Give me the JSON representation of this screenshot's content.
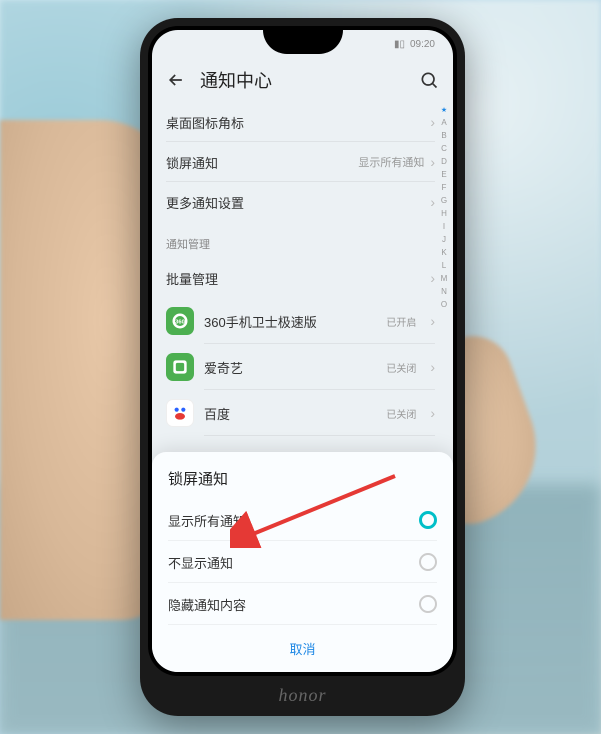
{
  "status": {
    "time": "09:20"
  },
  "header": {
    "title": "通知中心"
  },
  "rows": [
    {
      "label": "桌面图标角标",
      "value": ""
    },
    {
      "label": "锁屏通知",
      "value": "显示所有通知"
    },
    {
      "label": "更多通知设置",
      "value": ""
    }
  ],
  "sections": {
    "manage": "通知管理",
    "batch": "批量管理"
  },
  "apps": [
    {
      "name": "360手机卫士极速版",
      "status": "已开启",
      "icon_bg": "#4caf50",
      "icon_glyph": "360"
    },
    {
      "name": "爱奇艺",
      "status": "已关闭",
      "icon_bg": "#4caf50",
      "icon_glyph": "iQ"
    },
    {
      "name": "百度",
      "status": "已关闭",
      "icon_bg": "#2196f3",
      "icon_glyph": "B"
    }
  ],
  "index_letters": [
    "★",
    "A",
    "B",
    "C",
    "D",
    "E",
    "F",
    "G",
    "H",
    "I",
    "J",
    "K",
    "L",
    "M",
    "N",
    "O"
  ],
  "sheet": {
    "title": "锁屏通知",
    "options": [
      {
        "label": "显示所有通知",
        "selected": true
      },
      {
        "label": "不显示通知",
        "selected": false
      },
      {
        "label": "隐藏通知内容",
        "selected": false
      }
    ],
    "cancel": "取消"
  },
  "brand": "honor"
}
